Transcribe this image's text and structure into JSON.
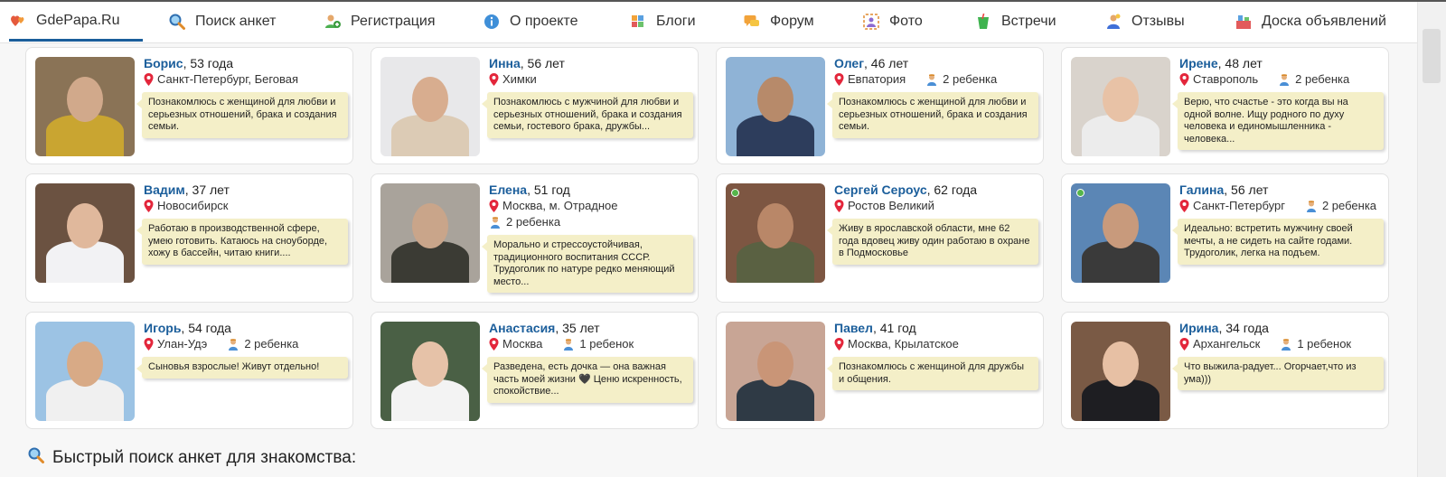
{
  "nav": [
    {
      "label": "GdePapa.Ru",
      "icon": "hearts-icon",
      "active": true
    },
    {
      "label": "Поиск анкет",
      "icon": "search-icon"
    },
    {
      "label": "Регистрация",
      "icon": "add-user-icon"
    },
    {
      "label": "О проекте",
      "icon": "info-icon"
    },
    {
      "label": "Блоги",
      "icon": "blog-icon"
    },
    {
      "label": "Форум",
      "icon": "forum-icon"
    },
    {
      "label": "Фото",
      "icon": "photo-icon"
    },
    {
      "label": "Встречи",
      "icon": "drink-icon"
    },
    {
      "label": "Отзывы",
      "icon": "reviews-icon"
    },
    {
      "label": "Доска объявлений",
      "icon": "board-icon"
    }
  ],
  "profiles": [
    {
      "name": "Борис",
      "age": ", 53 года",
      "location": "Санкт-Петербург, Беговая",
      "kids": "",
      "online": false,
      "about": "Познакомлюсь с женщиной для любви и серьезных отношений, брака и создания семьи.",
      "photo": {
        "bg": "#8a7356",
        "skin": "#d1a98b",
        "shirt": "#c9a531"
      }
    },
    {
      "name": "Инна",
      "age": ", 56 лет",
      "location": "Химки",
      "kids": "",
      "online": false,
      "about": "Познакомлюсь с мужчиной для любви и серьезных отношений, брака и создания семьи, гостевого брака, дружбы...",
      "photo": {
        "bg": "#e8e8ea",
        "skin": "#d8ad8f",
        "shirt": "#dccbb5"
      }
    },
    {
      "name": "Олег",
      "age": ", 46 лет",
      "location": "Евпатория",
      "kids": "2 ребенка",
      "online": false,
      "about": "Познакомлюсь с женщиной для любви и серьезных отношений, брака и создания семьи.",
      "photo": {
        "bg": "#8fb3d6",
        "skin": "#b78a6a",
        "shirt": "#2d3d5c"
      }
    },
    {
      "name": "Ирене",
      "age": ", 48 лет",
      "location": "Ставрополь",
      "kids": "2 ребенка",
      "online": false,
      "about": "Верю, что счастье - это когда вы на одной волне. Ищу родного по духу человека и единомышленника - человека...",
      "photo": {
        "bg": "#d9d3cc",
        "skin": "#e8c2a6",
        "shirt": "#ececec"
      }
    },
    {
      "name": "Вадим",
      "age": ", 37 лет",
      "location": "Новосибирск",
      "kids": "",
      "online": false,
      "about": "Работаю в производственной сфере, умею готовить. Катаюсь на сноуборде, хожу в бассейн, читаю книги....",
      "photo": {
        "bg": "#6b5241",
        "skin": "#e0b89c",
        "shirt": "#f2f2f4"
      }
    },
    {
      "name": "Елена",
      "age": ", 51 год",
      "location": "Москва, м. Отрадное",
      "kids": "2 ребенка",
      "online": false,
      "about": "Морально и стрессоустойчивая, традиционного воспитания СССР. Трудоголик по натуре редко меняющий место...",
      "photo": {
        "bg": "#a9a39b",
        "skin": "#c9a58a",
        "shirt": "#3b3b34"
      }
    },
    {
      "name": "Сергей Сероус",
      "age": ", 62 года",
      "location": "Ростов Великий",
      "kids": "",
      "online": true,
      "about": "Живу в ярославской области, мне 62 года вдовец живу один работаю в охране в Подмосковье",
      "photo": {
        "bg": "#7d5642",
        "skin": "#b98768",
        "shirt": "#5a6142"
      }
    },
    {
      "name": "Галина",
      "age": ", 56 лет",
      "location": "Санкт-Петербург",
      "kids": "2 ребенка",
      "online": true,
      "about": "Идеально: встретить мужчину своей мечты, а не сидеть на сайте годами. Трудоголик, легка на подъем.",
      "photo": {
        "bg": "#5b86b5",
        "skin": "#c89a7c",
        "shirt": "#3a3a3a"
      }
    },
    {
      "name": "Игорь",
      "age": ", 54 года",
      "location": "Улан-Удэ",
      "kids": "2 ребенка",
      "online": false,
      "about": "Сыновья взрослые! Живут отдельно!",
      "photo": {
        "bg": "#9cc3e4",
        "skin": "#d8aa86",
        "shirt": "#f0f0f0"
      }
    },
    {
      "name": "Анастасия",
      "age": ", 35 лет",
      "location": "Москва",
      "kids": "1 ребенок",
      "online": false,
      "about": "Разведена, есть дочка — она важная часть моей жизни 🖤 Ценю искренность, спокойствие...",
      "photo": {
        "bg": "#4a6045",
        "skin": "#e6c2a8",
        "shirt": "#f3f3f3"
      }
    },
    {
      "name": "Павел",
      "age": ", 41 год",
      "location": "Москва, Крылатское",
      "kids": "",
      "online": false,
      "about": "Познакомлюсь с женщиной для дружбы и общения.",
      "photo": {
        "bg": "#c8a595",
        "skin": "#c99577",
        "shirt": "#2f3a45"
      }
    },
    {
      "name": "Ирина",
      "age": ", 34 года",
      "location": "Архангельск",
      "kids": "1 ребенок",
      "online": false,
      "about": "Что выжила-радует... Огорчает,что из ума)))",
      "photo": {
        "bg": "#7a5a45",
        "skin": "#e7c0a4",
        "shirt": "#1e1e22"
      }
    }
  ],
  "quick_search": {
    "label": "Быстрый поиск анкет для знакомства:",
    "icon": "search-icon"
  }
}
